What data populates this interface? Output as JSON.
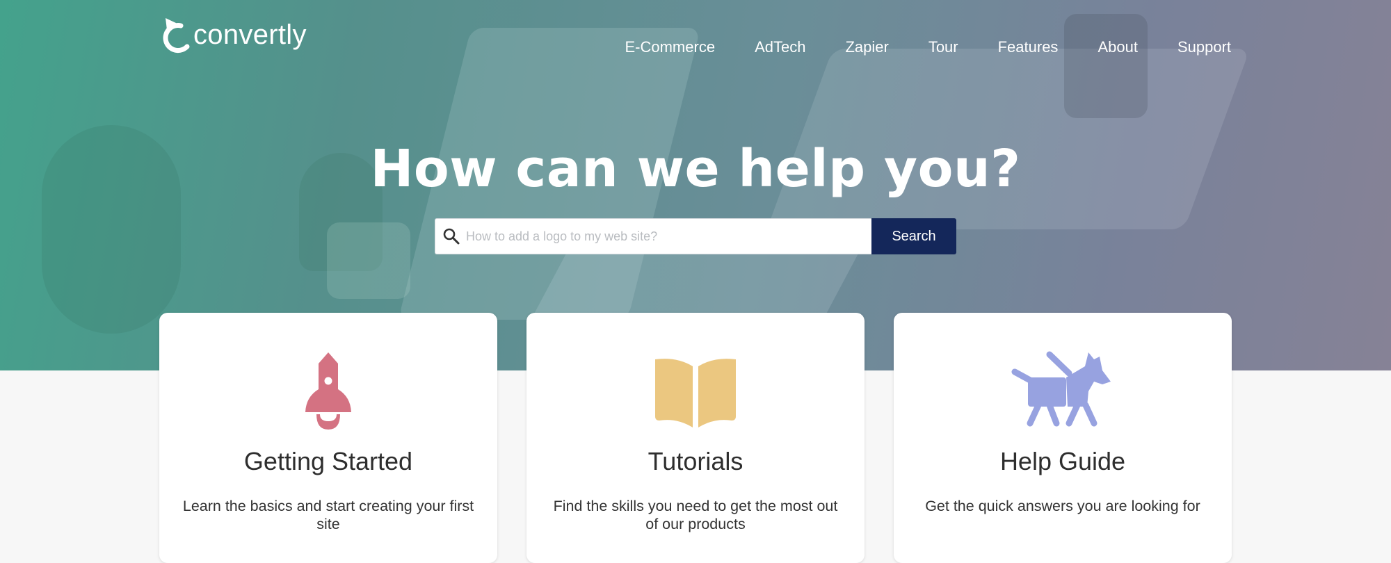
{
  "brand": {
    "name": "convertly"
  },
  "nav": {
    "items": [
      {
        "label": "E-Commerce"
      },
      {
        "label": "AdTech"
      },
      {
        "label": "Zapier"
      },
      {
        "label": "Tour"
      },
      {
        "label": "Features"
      },
      {
        "label": "About"
      },
      {
        "label": "Support"
      }
    ]
  },
  "hero": {
    "title": "How can we help you?",
    "search": {
      "placeholder": "How to add a logo to my web site?",
      "value": "",
      "button_label": "Search",
      "icon": "search-icon"
    }
  },
  "cards": [
    {
      "icon": "rocket-icon",
      "title": "Getting Started",
      "description": "Learn the basics and start creating your first site",
      "icon_color": "#d47282"
    },
    {
      "icon": "open-book-icon",
      "title": "Tutorials",
      "description": "Find the skills you need to get the most out of our products",
      "icon_color": "#ebc780"
    },
    {
      "icon": "guide-dog-icon",
      "title": "Help Guide",
      "description": "Get the quick answers you are looking for",
      "icon_color": "#97a2e0"
    }
  ],
  "colors": {
    "hero_gradient_start": "#44a28c",
    "hero_gradient_end": "#868296",
    "search_button": "#14275a",
    "page_background": "#f7f7f7"
  }
}
